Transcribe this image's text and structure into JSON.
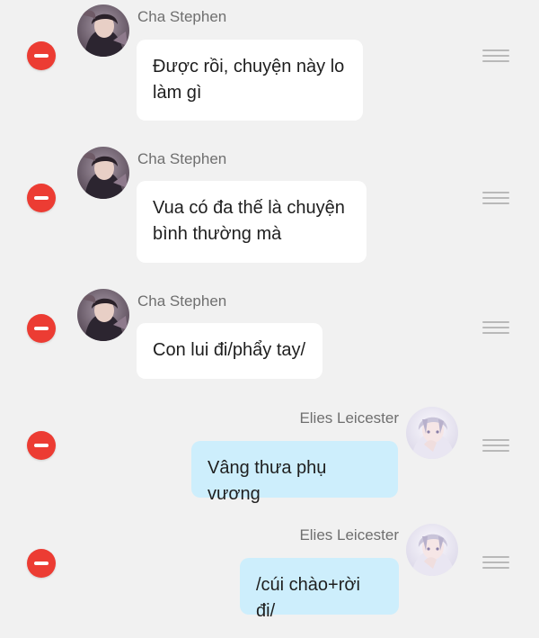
{
  "messages": [
    {
      "side": "left",
      "sender": "Cha Stephen",
      "text": "Được rồi, chuyện này lo làm gì",
      "avatar_icon": "dark-haired-character-avatar"
    },
    {
      "side": "left",
      "sender": "Cha Stephen",
      "text": "Vua có đa thế là chuyện bình thường mà",
      "avatar_icon": "dark-haired-character-avatar"
    },
    {
      "side": "left",
      "sender": "Cha Stephen",
      "text": "Con lui đi/phẩy tay/",
      "avatar_icon": "dark-haired-character-avatar"
    },
    {
      "side": "right",
      "sender": "Elies Leicester",
      "text": "Vâng thưa phụ vương",
      "avatar_icon": "light-haired-character-avatar"
    },
    {
      "side": "right",
      "sender": "Elies Leicester",
      "text": "/cúi chào+rời đi/",
      "avatar_icon": "light-haired-character-avatar"
    }
  ],
  "colors": {
    "background": "#f1f1f1",
    "delete_button": "#ec3c33",
    "left_bubble": "#ffffff",
    "right_bubble": "#cdeefc",
    "sender_text": "#6f6f6f",
    "drag_handle": "#b9b9b9"
  }
}
